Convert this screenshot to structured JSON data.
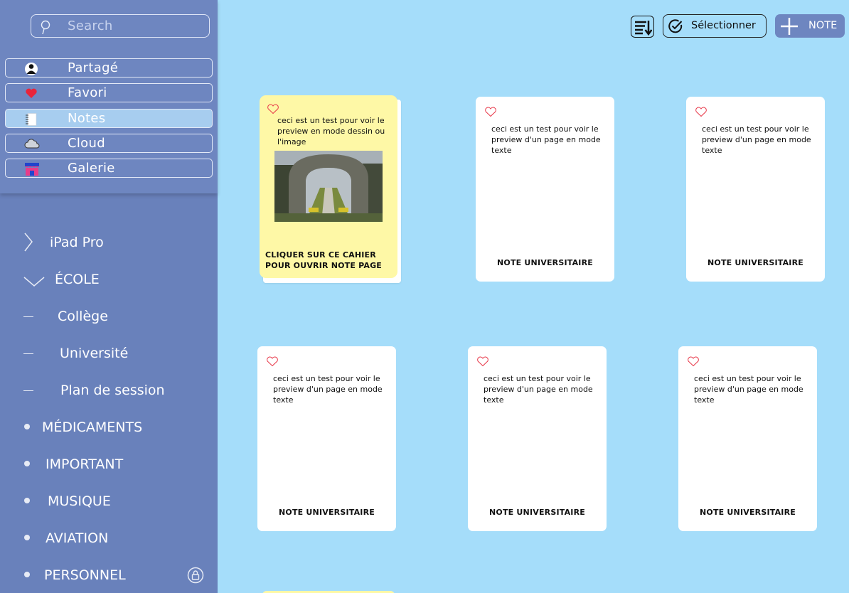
{
  "sidebar": {
    "search_placeholder": "Search",
    "nav": [
      {
        "label": "Partagé",
        "icon": "person-icon",
        "active": false
      },
      {
        "label": "Favori",
        "icon": "heart-icon",
        "active": false
      },
      {
        "label": "Notes",
        "icon": "notebook-icon",
        "active": true
      },
      {
        "label": "Cloud",
        "icon": "cloud-icon",
        "active": false
      },
      {
        "label": "Galerie",
        "icon": "shop-icon",
        "active": false
      }
    ],
    "tree": [
      {
        "label": "iPad Pro",
        "glyph": "chevron-right-icon"
      },
      {
        "label": "ÉCOLE",
        "glyph": "chevron-down-icon"
      },
      {
        "label": "Collège",
        "glyph": "dash-icon"
      },
      {
        "label": "Université",
        "glyph": "dash-icon"
      },
      {
        "label": "Plan de session",
        "glyph": "dash-icon"
      },
      {
        "label": "MÉDICAMENTS",
        "glyph": "bullet-icon"
      },
      {
        "label": "IMPORTANT",
        "glyph": "bullet-icon"
      },
      {
        "label": "MUSIQUE",
        "glyph": "bullet-icon"
      },
      {
        "label": "AVIATION",
        "glyph": "bullet-icon"
      },
      {
        "label": "PERSONNEL",
        "glyph": "bullet-icon",
        "lock": "lock-icon"
      }
    ]
  },
  "toolbar": {
    "sort_icon": "sort-list-icon",
    "select_label": "Sélectionner",
    "new_note_label": "NOTE"
  },
  "cards": [
    {
      "preview": "ceci est un test pour voir le preview en mode dessin ou l'image",
      "title": "CLIQUER SUR CE CAHIER POUR OUVRIR NOTE PAGE",
      "featured": true
    },
    {
      "preview": "ceci est un test pour voir le preview d'un page en mode texte",
      "title": "NOTE UNIVERSITAIRE"
    },
    {
      "preview": "ceci est un test pour voir le preview d'un page en mode texte",
      "title": "NOTE UNIVERSITAIRE"
    },
    {
      "preview": "ceci est un test pour voir le preview d'un page en mode texte",
      "title": "NOTE UNIVERSITAIRE"
    },
    {
      "preview": "ceci est un test pour voir le preview d'un page en mode texte",
      "title": "NOTE UNIVERSITAIRE"
    },
    {
      "preview": "ceci est un test pour voir le preview d'un page en mode texte",
      "title": "NOTE UNIVERSITAIRE"
    }
  ],
  "colors": {
    "background": "#a5ddfa",
    "sidebar": "#6981bb",
    "active_nav": "#a7cdef",
    "featured_card": "#fef8a6",
    "heart": "#e8394a"
  }
}
